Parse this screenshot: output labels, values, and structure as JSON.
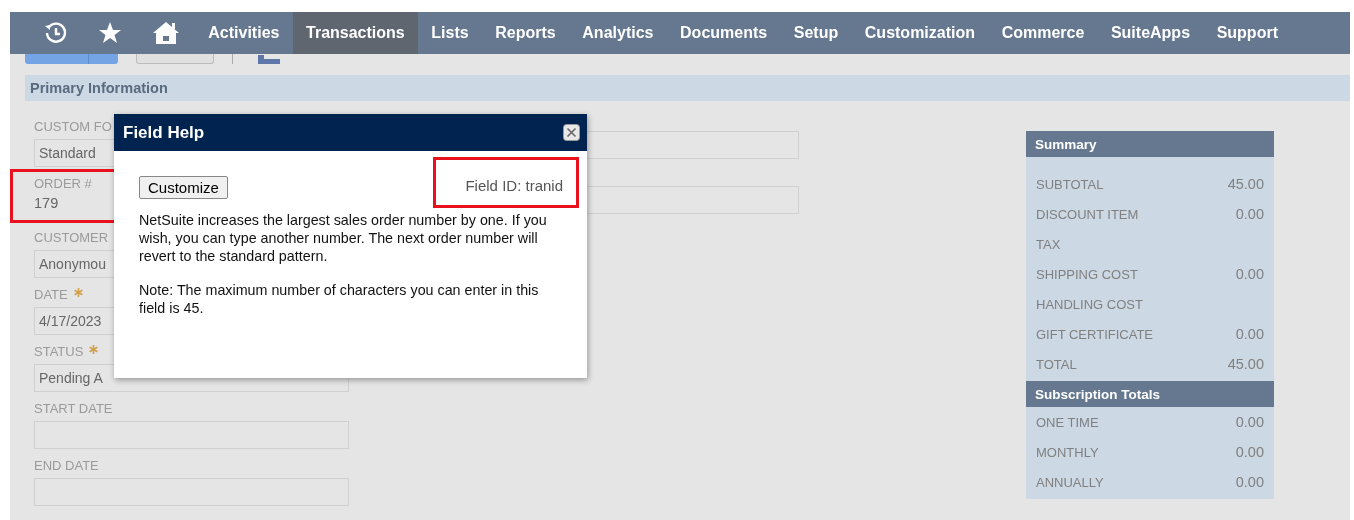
{
  "nav": {
    "items": [
      {
        "label": "Activities",
        "selected": false
      },
      {
        "label": "Transactions",
        "selected": true
      },
      {
        "label": "Lists",
        "selected": false
      },
      {
        "label": "Reports",
        "selected": false
      },
      {
        "label": "Analytics",
        "selected": false
      },
      {
        "label": "Documents",
        "selected": false
      },
      {
        "label": "Setup",
        "selected": false
      },
      {
        "label": "Customization",
        "selected": false
      },
      {
        "label": "Commerce",
        "selected": false
      },
      {
        "label": "SuiteApps",
        "selected": false
      },
      {
        "label": "Support",
        "selected": false
      }
    ]
  },
  "section_title": "Primary Information",
  "form": {
    "fields": [
      {
        "label": "CUSTOM FO",
        "kind": "select",
        "value": "Standard",
        "required": false,
        "highlighted": false
      },
      {
        "label": "ORDER #",
        "kind": "text",
        "value": "179",
        "required": false,
        "highlighted": true
      },
      {
        "label": "CUSTOMER",
        "kind": "select",
        "value": "Anonymou",
        "required": false,
        "highlighted": false
      },
      {
        "label": "DATE",
        "kind": "input",
        "value": "4/17/2023",
        "required": true,
        "highlighted": false
      },
      {
        "label": "STATUS",
        "kind": "select",
        "value": "Pending A",
        "required": true,
        "highlighted": false
      },
      {
        "label": "START DATE",
        "kind": "input",
        "required": false,
        "highlighted": false
      },
      {
        "label": "END DATE",
        "kind": "input",
        "required": false,
        "highlighted": false
      }
    ]
  },
  "field_help": {
    "title": "Field Help",
    "button": "Customize",
    "field_id": "Field ID: tranid",
    "field_id_highlighted": true,
    "paragraphs": [
      "NetSuite increases the largest sales order number by one. If you wish, you can type another number. The next order number will revert to the standard pattern.",
      "Note: The maximum number of characters you can enter in this field is 45."
    ]
  },
  "summary": {
    "sections": [
      {
        "title": "Summary",
        "rows": [
          {
            "label": "SUBTOTAL",
            "value": "45.00"
          },
          {
            "label": "DISCOUNT ITEM",
            "value": "0.00"
          },
          {
            "label": "TAX"
          },
          {
            "label": "SHIPPING COST",
            "value": "0.00"
          },
          {
            "label": "HANDLING COST"
          },
          {
            "label": "GIFT CERTIFICATE",
            "value": "0.00"
          },
          {
            "label": "TOTAL",
            "value": "45.00"
          }
        ]
      },
      {
        "title": "Subscription Totals",
        "rows": [
          {
            "label": "ONE TIME",
            "value": "0.00"
          },
          {
            "label": "MONTHLY",
            "value": "0.00"
          },
          {
            "label": "ANNUALLY",
            "value": "0.00"
          }
        ]
      }
    ]
  }
}
